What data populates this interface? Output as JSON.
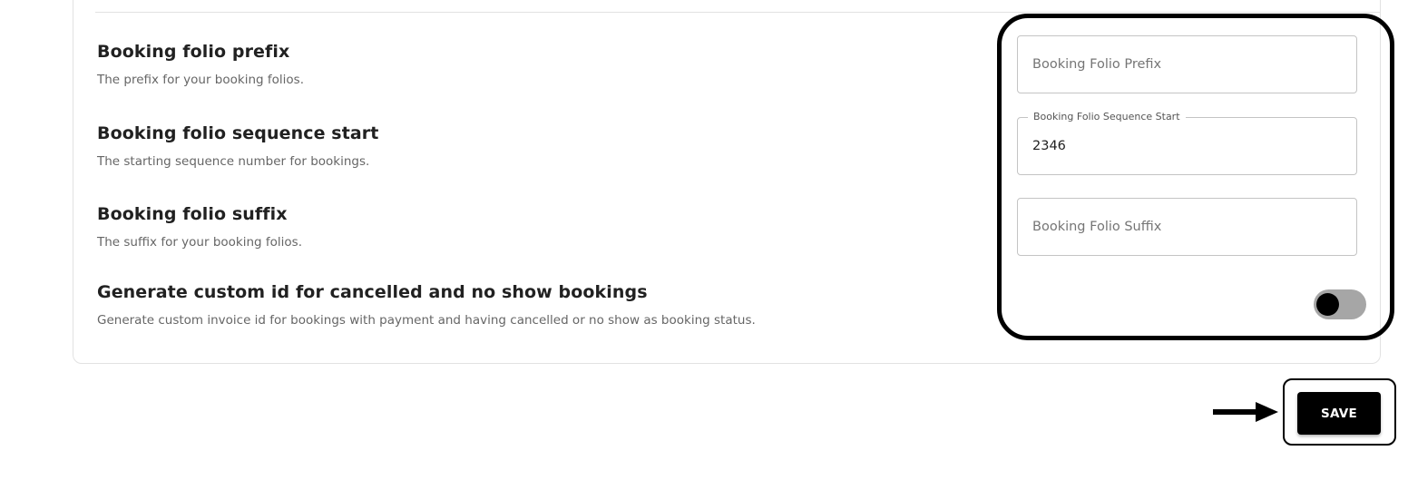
{
  "settings": {
    "rows": [
      {
        "title": "Booking folio prefix",
        "description": "The prefix for your booking folios."
      },
      {
        "title": "Booking folio sequence start",
        "description": "The starting sequence number for bookings."
      },
      {
        "title": "Booking folio suffix",
        "description": "The suffix for your booking folios."
      },
      {
        "title": "Generate custom id for cancelled and no show bookings",
        "description": "Generate custom invoice id for bookings with payment and having cancelled or no show as booking status."
      }
    ],
    "fields": {
      "prefix": {
        "placeholder": "Booking Folio Prefix",
        "value": ""
      },
      "sequence_start": {
        "label": "Booking Folio Sequence Start",
        "value": "2346"
      },
      "suffix": {
        "placeholder": "Booking Folio Suffix",
        "value": ""
      }
    },
    "custom_id_toggle": {
      "on": false
    }
  },
  "actions": {
    "save_label": "SAVE"
  },
  "colors": {
    "accent": "#000000",
    "toggle_track": "#a6a6a6",
    "border": "#c4c4c4"
  },
  "icons": {
    "annotation_arrow": "arrow-right-icon"
  }
}
